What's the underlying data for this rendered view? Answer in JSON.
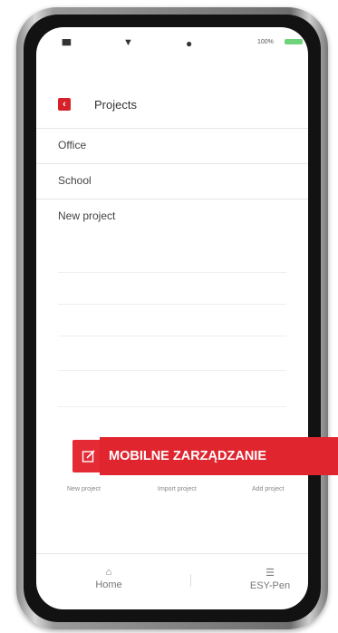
{
  "status_bar": {
    "signal": "▮▮▮",
    "battery_text": "100%"
  },
  "header": {
    "title": "Projects",
    "back_icon": "back-icon",
    "search_icon": "search-icon"
  },
  "projects": [
    {
      "name": "Office"
    },
    {
      "name": "School"
    },
    {
      "name": "New project"
    }
  ],
  "actions": {
    "new_project": "New project",
    "import_project": "Import project",
    "add_project": "Add project"
  },
  "bottom_nav": {
    "home": "Home",
    "esy_pen": "ESY-Pen"
  },
  "banner": {
    "text": "MOBILNE ZARZĄDZANIE"
  },
  "colors": {
    "accent": "#e1252f",
    "text": "#444444"
  }
}
